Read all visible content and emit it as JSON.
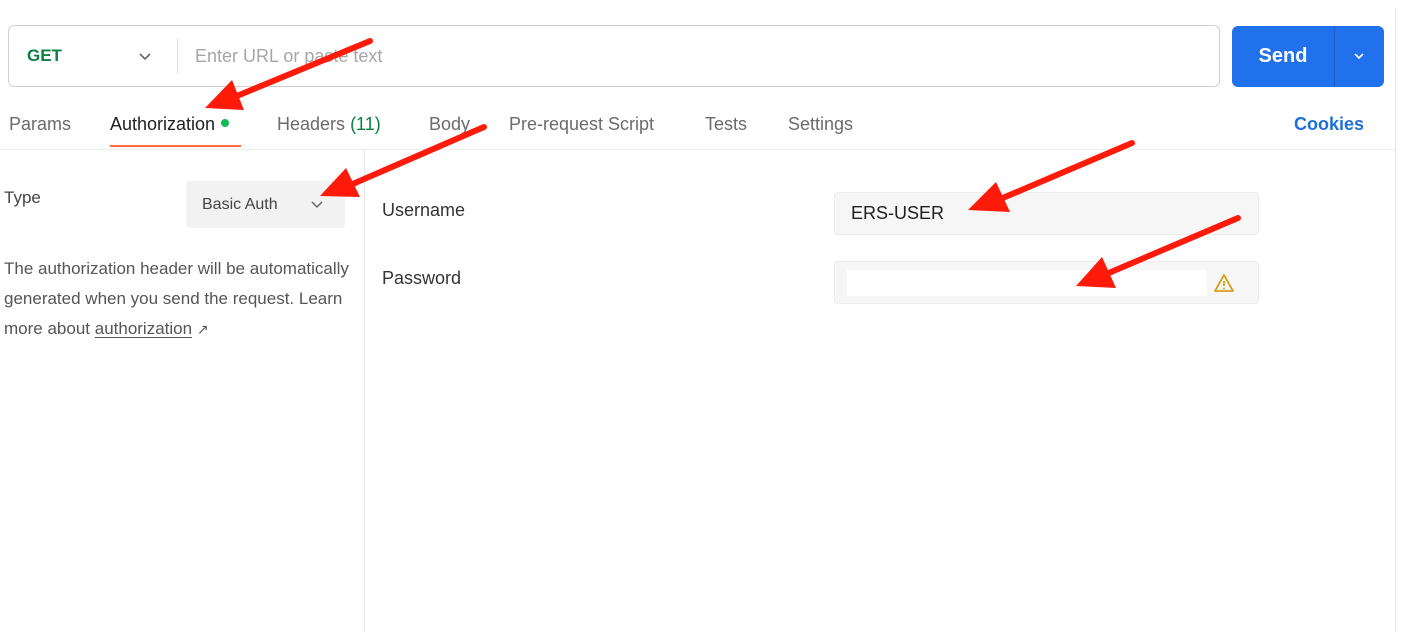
{
  "request": {
    "method": "GET",
    "url_value": "",
    "url_placeholder": "Enter URL or paste text",
    "send_label": "Send"
  },
  "tabs": [
    {
      "label": "Params"
    },
    {
      "label": "Authorization",
      "active": true,
      "indicator": "green-dot"
    },
    {
      "label": "Headers",
      "count": "(11)"
    },
    {
      "label": "Body"
    },
    {
      "label": "Pre-request Script"
    },
    {
      "label": "Tests"
    },
    {
      "label": "Settings"
    }
  ],
  "cookies_label": "Cookies",
  "auth": {
    "type_label": "Type",
    "type_value": "Basic Auth",
    "description": "The authorization header will be automatically generated when you send the request. Learn more about",
    "link_text": "authorization",
    "link_icon": "↗",
    "username_label": "Username",
    "username_value": "ERS-USER",
    "password_label": "Password",
    "password_value": "",
    "password_warning_icon": "warning-triangle-icon"
  },
  "colors": {
    "accent_blue": "#2170ec",
    "method_green": "#0b8043",
    "tab_underline": "#ff6c37",
    "annotation_arrow": "#ff1a0a",
    "cookies_link": "#1e6fd9",
    "warning": "#d3a017"
  }
}
